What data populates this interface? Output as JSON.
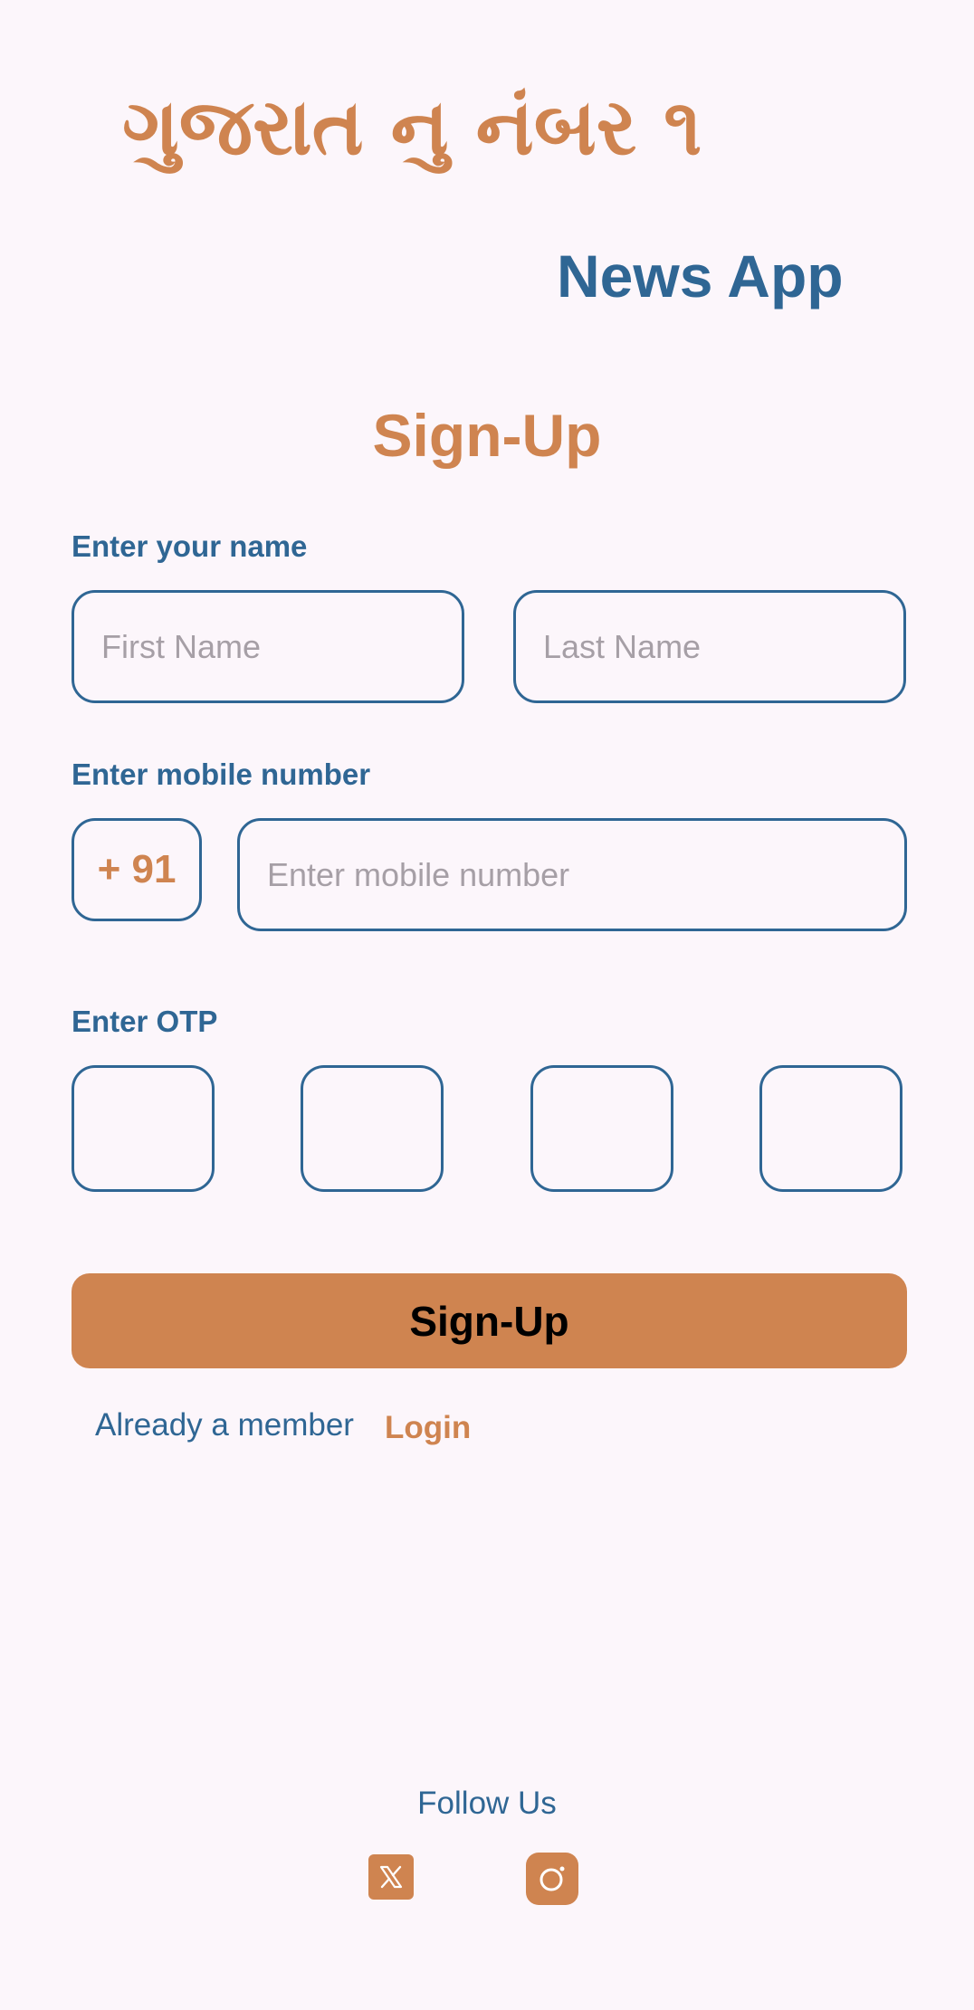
{
  "header": {
    "headline": "ગુજરાત નુ નંબર ૧",
    "app_name": "News App"
  },
  "form": {
    "title": "Sign-Up",
    "name_label": "Enter your name",
    "first_name_placeholder": "First Name",
    "last_name_placeholder": "Last Name",
    "mobile_label": "Enter mobile number",
    "country_code": "+ 91",
    "mobile_placeholder": "Enter mobile number",
    "otp_label": "Enter OTP",
    "otp_values": [
      "",
      "",
      "",
      ""
    ],
    "submit_label": "Sign-Up"
  },
  "login_prompt": {
    "text": "Already a member",
    "link": "Login"
  },
  "footer": {
    "follow_label": "Follow Us",
    "social_icons": [
      "x-twitter-icon",
      "instagram-icon"
    ]
  },
  "colors": {
    "accent": "#cf8450",
    "primary": "#2f6694",
    "background": "#fcf6fb",
    "placeholder": "#a69fa6"
  }
}
